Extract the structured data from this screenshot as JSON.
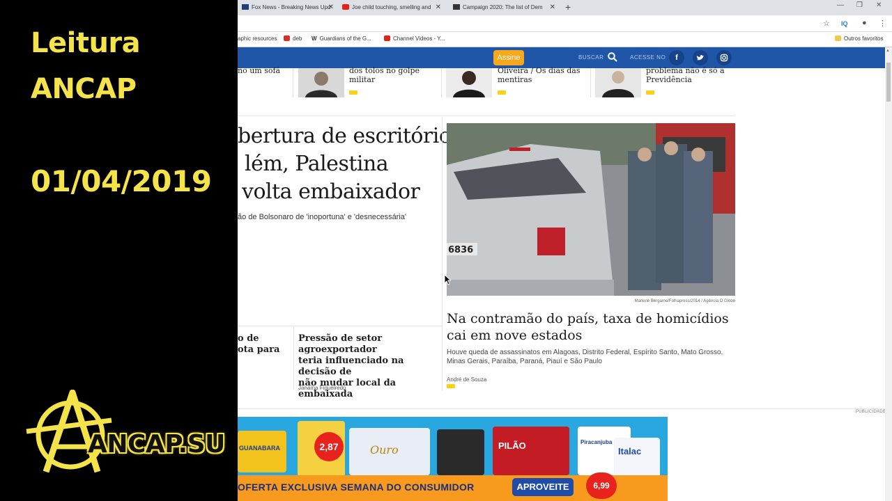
{
  "overlay": {
    "title_line1": "Leitura",
    "title_line2": "ANCAP",
    "date": "01/04/2019",
    "logo_text": "ANCAP.SU"
  },
  "browser": {
    "tabs": [
      {
        "label": "Fox News - Breaking News Upd",
        "icon_color": "#1f3d7a"
      },
      {
        "label": "Joe child touching, smelling and",
        "icon_color": "#e62117"
      },
      {
        "label": "Campaign 2020: The list of Dem",
        "icon_color": "#333333"
      }
    ],
    "bookmarks": [
      {
        "label": "aphic resources"
      },
      {
        "label": "deb",
        "icon_color": "#d93025"
      },
      {
        "label": "Guardians of the G...",
        "icon_glyph": "W"
      },
      {
        "label": "Channel Videos - Y...",
        "icon_color": "#e62117"
      },
      {
        "label": "Outros favoritos",
        "icon_color": "#f2c94c"
      }
    ],
    "addr_icons": [
      "star-icon",
      "iq-icon",
      "extension-icon",
      "menu-icon"
    ],
    "iq_label": "IQ"
  },
  "site": {
    "brand_color": "#2056a8",
    "assine_label": "Assine",
    "buscar_label": "BUSCAR",
    "acesse_label": "ACESSE NO",
    "social": [
      "f",
      "t",
      "i"
    ]
  },
  "columnists": [
    {
      "text_line1": "no um sofá",
      "text_line2": ""
    },
    {
      "text_line1": "dos tolos no golpe",
      "text_line2": "militar"
    },
    {
      "text_line1": "Oliveira / Os dias das",
      "text_line2": "mentiras"
    },
    {
      "text_line1": "problema não é só a",
      "text_line2": "Previdência"
    }
  ],
  "main": {
    "headline_line1": "bertura de escritório",
    "headline_line2": "lém, Palestina",
    "headline_line3": "volta embaixador",
    "subhead": "ão de Bolsonaro de 'inoportuna' e 'desnecessária'"
  },
  "side_story": {
    "photo_credit": "Marlene Bergamo/Folhapress/2014 / Agência O Globo",
    "headline": "Na contramão do país, taxa de homicídios cai em nove estados",
    "summary": "Houve queda de assassinatos em Alagoas, Distrito Federal, Espírito Santo, Mato Grosso, Minas Gerais, Paraíba, Paraná, Piauí e São Paulo",
    "author": "André de Souza",
    "plate_text": "6836"
  },
  "bottom_stories": [
    {
      "line1": "o de",
      "line2": "ota para",
      "line3": ""
    },
    {
      "line1": "Pressão de setor agroexportador",
      "line2": "teria influenciado na decisão de",
      "line3": "não mudar local da embaixada",
      "author": "Janaína Figueiredo"
    }
  ],
  "ad": {
    "publicidade": "PUBLICIDADE",
    "offer_text": "OFERTA EXCLUSIVA SEMANA DO CONSUMIDOR",
    "button": "APROVEITE",
    "store": "GUANABARA",
    "price1": "2,87",
    "brand1": "Ouro",
    "brand2": "PILÃO",
    "brand3": "Piracanjuba",
    "brand4": "Italac",
    "price2": "6,99"
  }
}
